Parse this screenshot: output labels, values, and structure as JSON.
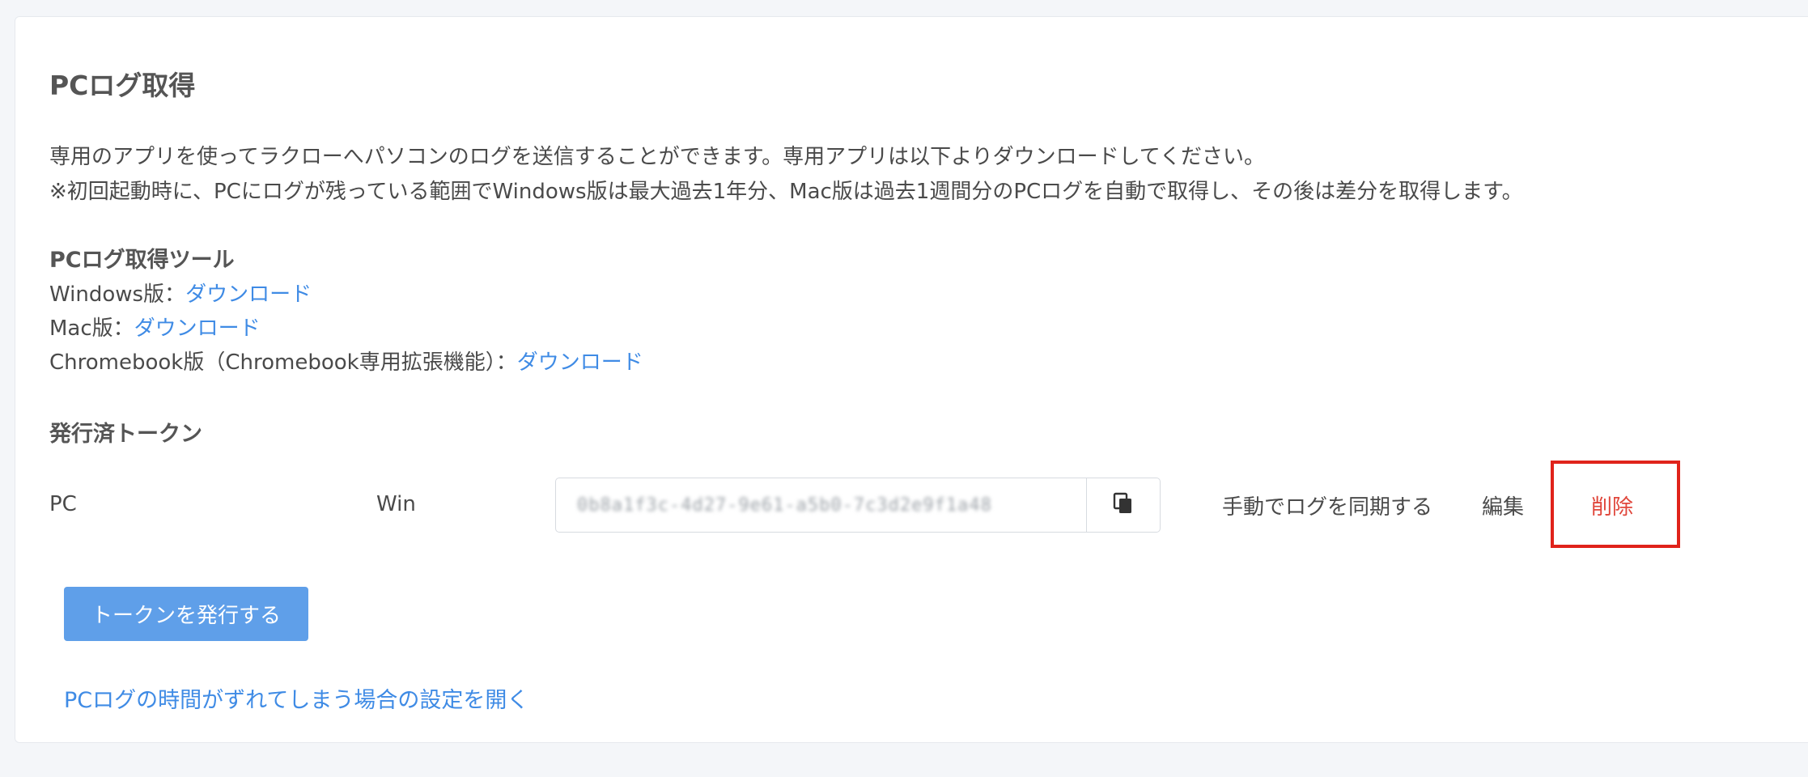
{
  "section": {
    "title": "PCログ取得",
    "description_line1": "専用のアプリを使ってラクローへパソコンのログを送信することができます。専用アプリは以下よりダウンロードしてください。",
    "description_line2": "※初回起動時に、PCにログが残っている範囲でWindows版は最大過去1年分、Mac版は過去1週間分のPCログを自動で取得し、その後は差分を取得します。"
  },
  "tools": {
    "heading": "PCログ取得ツール",
    "items": [
      {
        "label": "Windows版：",
        "link": "ダウンロード"
      },
      {
        "label": "Mac版：",
        "link": "ダウンロード"
      },
      {
        "label": "Chromebook版（Chromebook専用拡張機能）：",
        "link": "ダウンロード"
      }
    ]
  },
  "tokens": {
    "heading": "発行済トークン",
    "rows": [
      {
        "name": "PC",
        "os": "Win",
        "token_value": "0b8a1f3c-4d27-9e61-a5b0-7c3d2e9f1a48",
        "sync_label": "手動でログを同期する",
        "edit_label": "編集",
        "delete_label": "削除"
      }
    ],
    "issue_button": "トークンを発行する"
  },
  "settings_link": "PCログの時間がずれてしまう場合の設定を開く",
  "colors": {
    "link": "#3f8be5",
    "primary_button": "#5f9fe9",
    "delete_text": "#e0463b",
    "highlight_box": "#e0231b"
  },
  "icons": {
    "copy": "copy-icon"
  }
}
